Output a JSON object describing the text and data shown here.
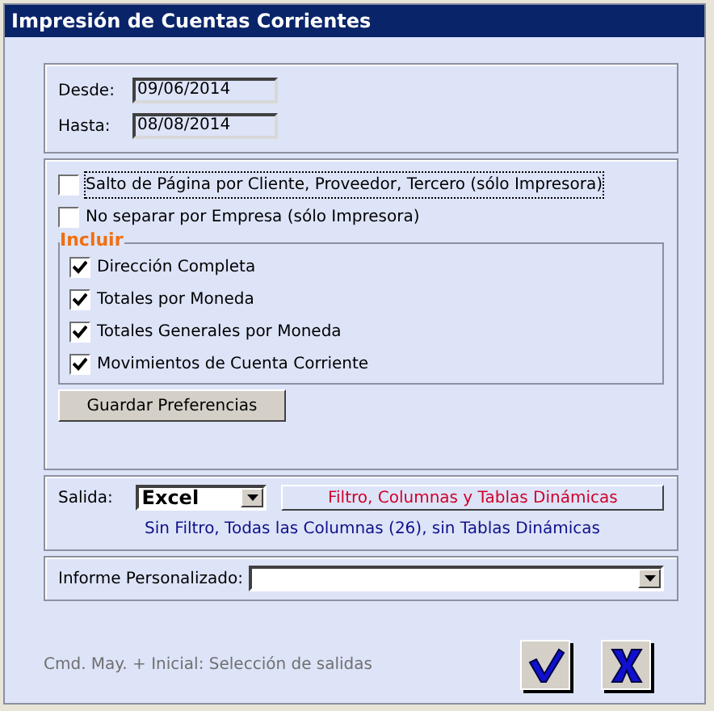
{
  "window": {
    "title": "Impresión de Cuentas Corrientes"
  },
  "dates": [
    {
      "label": "Desde:",
      "value": "09/06/2014"
    },
    {
      "label": "Hasta:",
      "value": "08/08/2014"
    }
  ],
  "options": [
    {
      "label": "Salto de Página por Cliente, Proveedor, Tercero (sólo Impresora)",
      "checked": false,
      "focused": true
    },
    {
      "label": "No separar por Empresa (sólo Impresora)",
      "checked": false,
      "focused": false
    }
  ],
  "include": {
    "title": "Incluir",
    "items": [
      {
        "label": "Dirección Completa",
        "checked": true
      },
      {
        "label": "Totales por Moneda",
        "checked": true
      },
      {
        "label": "Totales Generales por Moneda",
        "checked": true
      },
      {
        "label": "Movimientos de Cuenta Corriente",
        "checked": true
      }
    ]
  },
  "save_button": "Guardar Preferencias",
  "output": {
    "label": "Salida:",
    "value": "Excel",
    "filter_button": "Filtro, Columnas y Tablas Dinámicas",
    "summary": "Sin Filtro, Todas las Columnas (26), sin Tablas Dinámicas"
  },
  "custom_report": {
    "label": "Informe Personalizado:"
  },
  "hint": "Cmd. May. + Inicial: Selección de salidas"
}
